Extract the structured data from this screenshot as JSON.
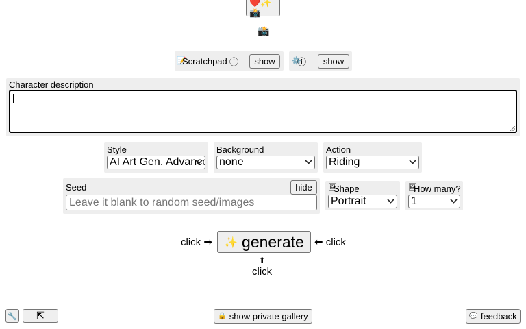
{
  "top": {
    "emoji_button": "❤️✨📸",
    "emoji_line": "📸"
  },
  "tools": [
    {
      "icon": "📝",
      "label": "Scratchpad",
      "info_icon": "ⓘ",
      "button": "show"
    },
    {
      "icon": "⚙️",
      "label": "",
      "info_icon": "ⓘ",
      "button": "show"
    }
  ],
  "description": {
    "label": "Character description",
    "value": ""
  },
  "selects": {
    "style": {
      "label": "Style",
      "value": "AI Art Gen. Advanced"
    },
    "background": {
      "label": "Background",
      "value": "none"
    },
    "action": {
      "label": "Action",
      "value": "Riding"
    },
    "shape": {
      "icon": "🖼",
      "label": "Shape",
      "value": "Portrait"
    },
    "count": {
      "icon": "🖼",
      "label": "How many?",
      "value": "1"
    }
  },
  "seed": {
    "label": "Seed",
    "hide_button": "hide",
    "placeholder": "Leave it blank to random seed/images"
  },
  "generate": {
    "left_text": "click ➡",
    "icon": "✨",
    "label": "generate",
    "right_text": "⬅ click",
    "below_arrow": "⬆",
    "below_text": "click"
  },
  "footer": {
    "left_icon_button": "🔧",
    "collapse_button": "⇱",
    "gallery_icon": "🔒",
    "gallery_label": "show private gallery",
    "feedback_icon": "💬",
    "feedback_label": "feedback"
  }
}
